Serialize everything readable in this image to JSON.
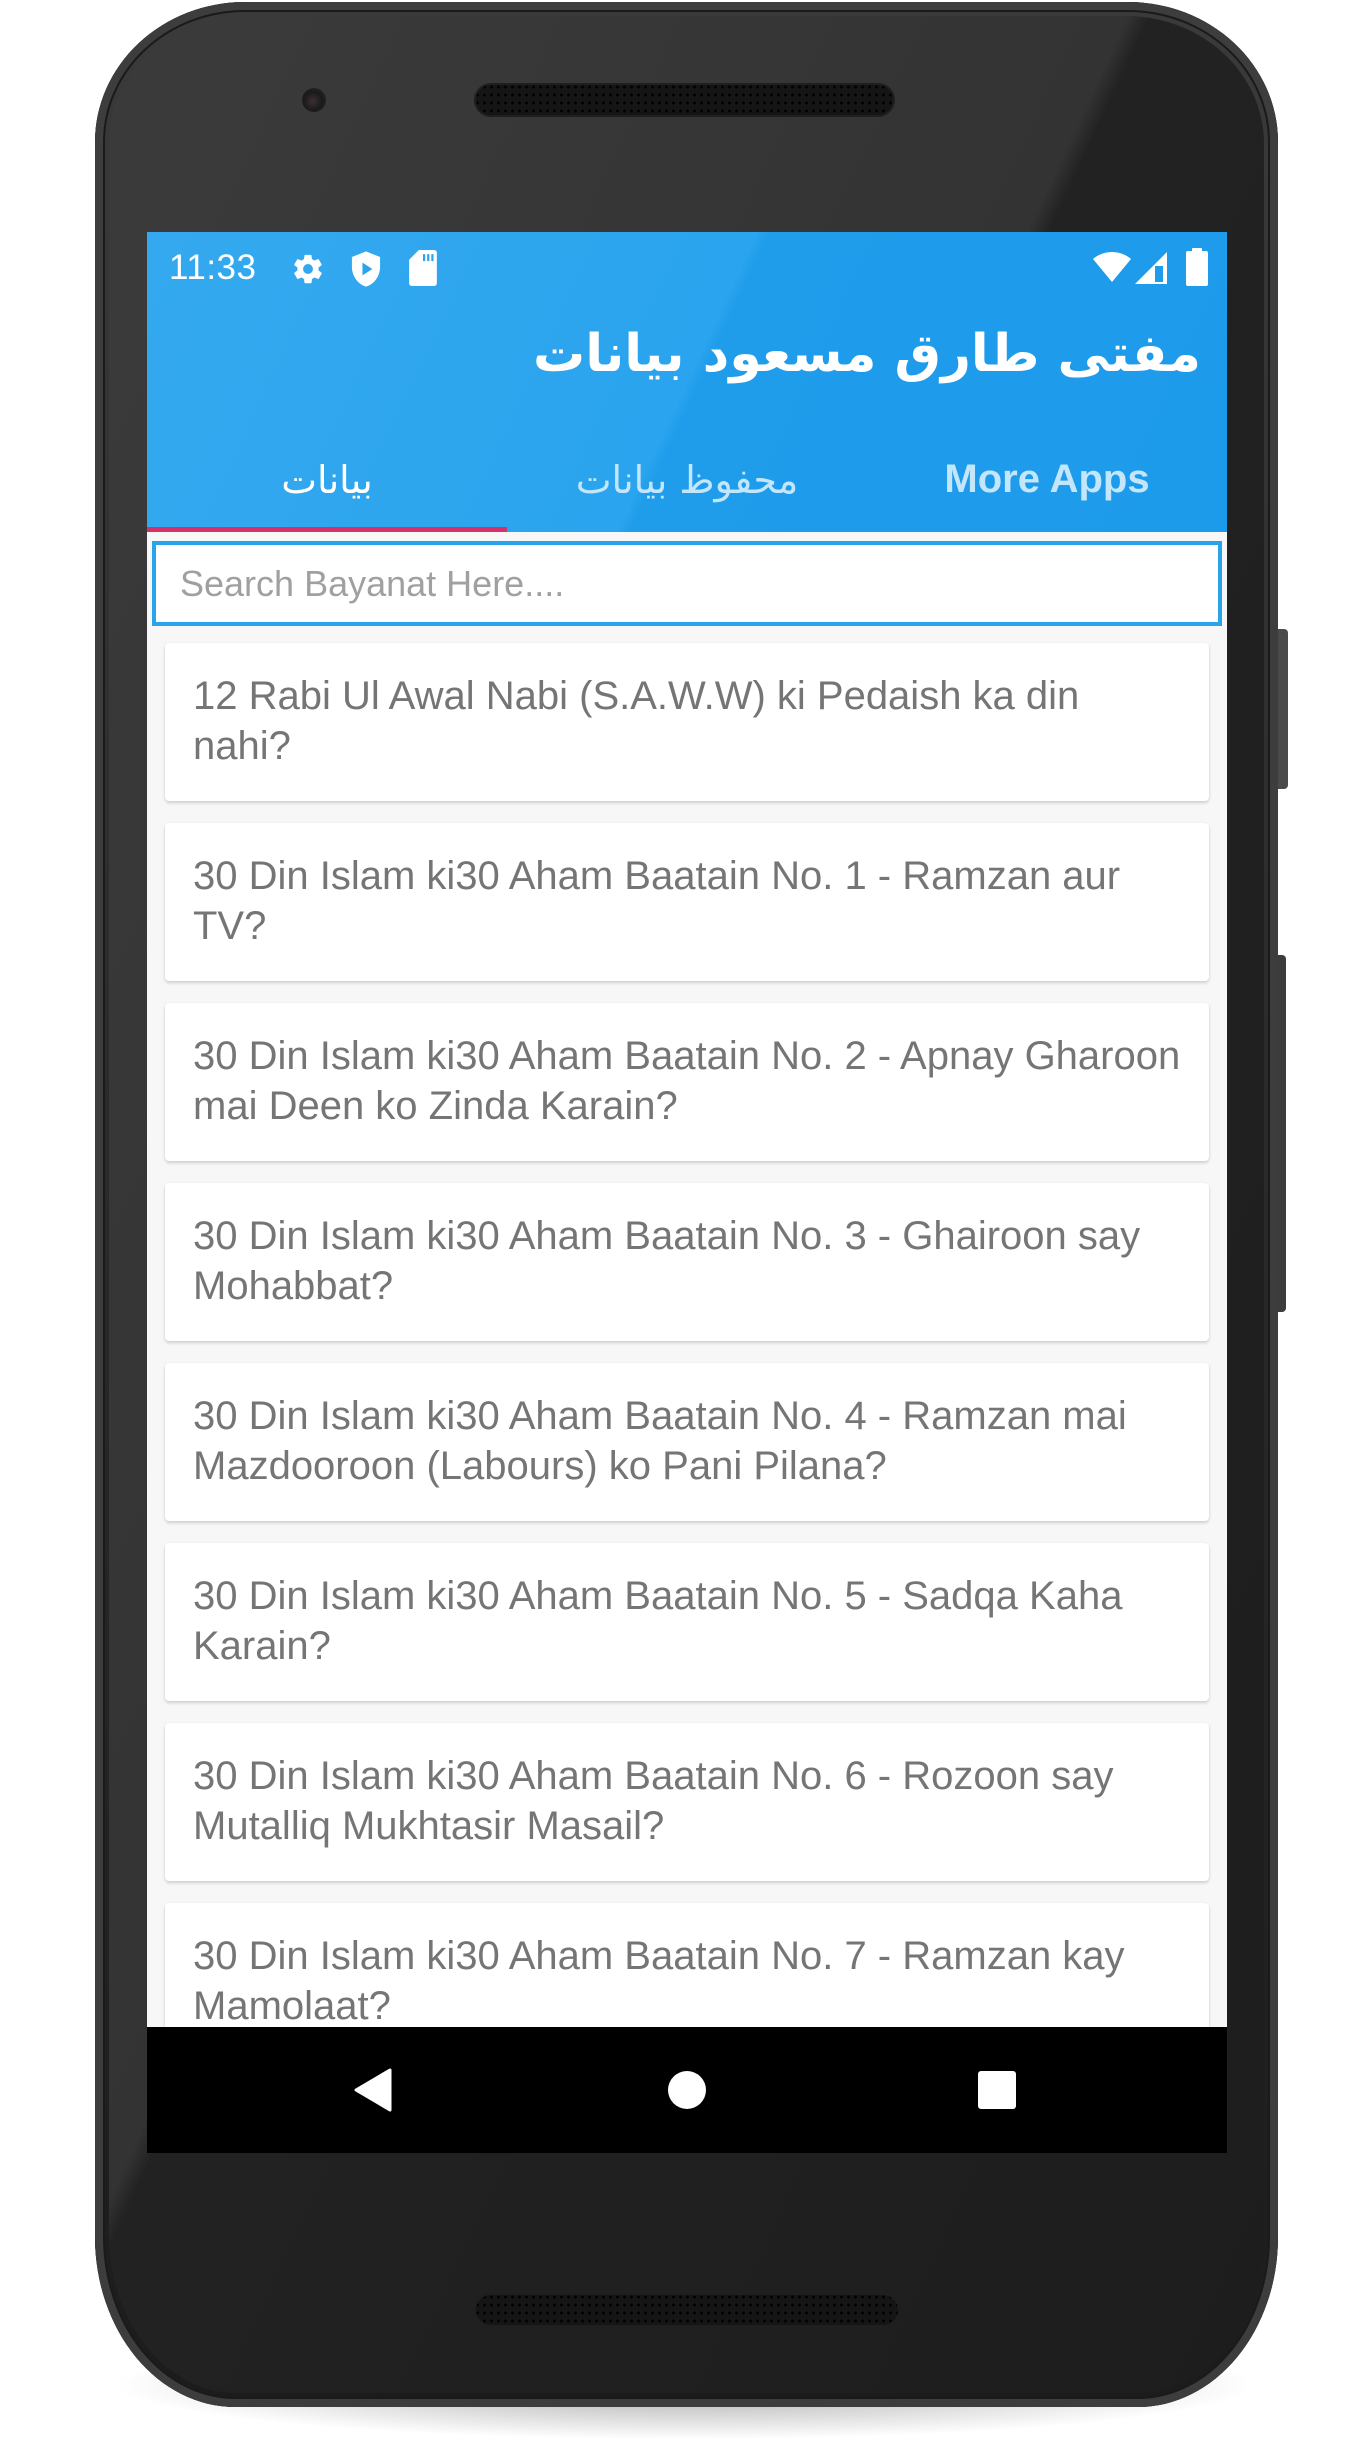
{
  "status_bar": {
    "time": "11:33",
    "left_icons": [
      "gear-icon",
      "shield-play-icon",
      "sd-card-icon"
    ],
    "right_icons": [
      "wifi-icon",
      "cell-signal-icon",
      "battery-icon"
    ]
  },
  "app_bar": {
    "title": "مفتی طارق مسعود بیانات",
    "color": "#29a3ec"
  },
  "tabs": [
    {
      "label": "بیانات",
      "active": true
    },
    {
      "label": "محفوظ بیانات",
      "active": false
    },
    {
      "label": "More Apps",
      "active": false
    }
  ],
  "tab_indicator_color": "#d6306b",
  "search": {
    "placeholder": "Search Bayanat Here....",
    "value": ""
  },
  "bayanat": [
    {
      "title": "12 Rabi Ul Awal Nabi (S.A.W.W) ki Pedaish ka din nahi?"
    },
    {
      "title": "30 Din Islam ki30 Aham Baatain No. 1 - Ramzan aur TV?"
    },
    {
      "title": "30 Din Islam ki30 Aham Baatain No. 2 - Apnay Gharoon mai Deen ko Zinda Karain?"
    },
    {
      "title": "30 Din Islam ki30 Aham Baatain No. 3 - Ghairoon say Mohabbat?"
    },
    {
      "title": "30 Din Islam ki30 Aham Baatain No. 4 - Ramzan mai Mazdooroon (Labours) ko Pani Pilana?"
    },
    {
      "title": "30 Din Islam ki30 Aham Baatain No. 5 - Sadqa Kaha Karain?"
    },
    {
      "title": "30 Din Islam ki30 Aham Baatain No. 6 - Rozoon say Mutalliq Mukhtasir Masail?"
    },
    {
      "title": "30 Din Islam ki30 Aham Baatain No. 7 - Ramzan kay Mamolaat?"
    }
  ],
  "nav_bar": {
    "buttons": [
      "back-icon",
      "home-icon",
      "recents-icon"
    ]
  }
}
